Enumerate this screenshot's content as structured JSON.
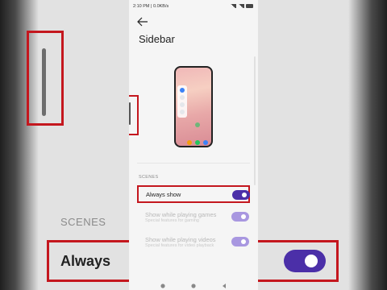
{
  "status": {
    "time": "2:10 PM",
    "speed": "0.0KB/s"
  },
  "page": {
    "title": "Sidebar"
  },
  "section": {
    "label": "SCENES"
  },
  "rows": [
    {
      "label": "Always show",
      "on": true
    },
    {
      "label": "Show while playing games",
      "sub": "Special features for gaming",
      "on": true
    },
    {
      "label": "Show while playing videos",
      "sub": "Special features for video playback",
      "on": true
    }
  ],
  "background": {
    "section_label": "SCENES",
    "row_label": "Always"
  },
  "colors": {
    "accent": "#4b2fa8",
    "accent_dim": "#a897e0",
    "highlight": "#c4171e"
  },
  "icons": [
    "back-arrow-icon",
    "signal-icon",
    "battery-icon",
    "recent-apps-icon",
    "home-icon",
    "back-nav-icon"
  ]
}
